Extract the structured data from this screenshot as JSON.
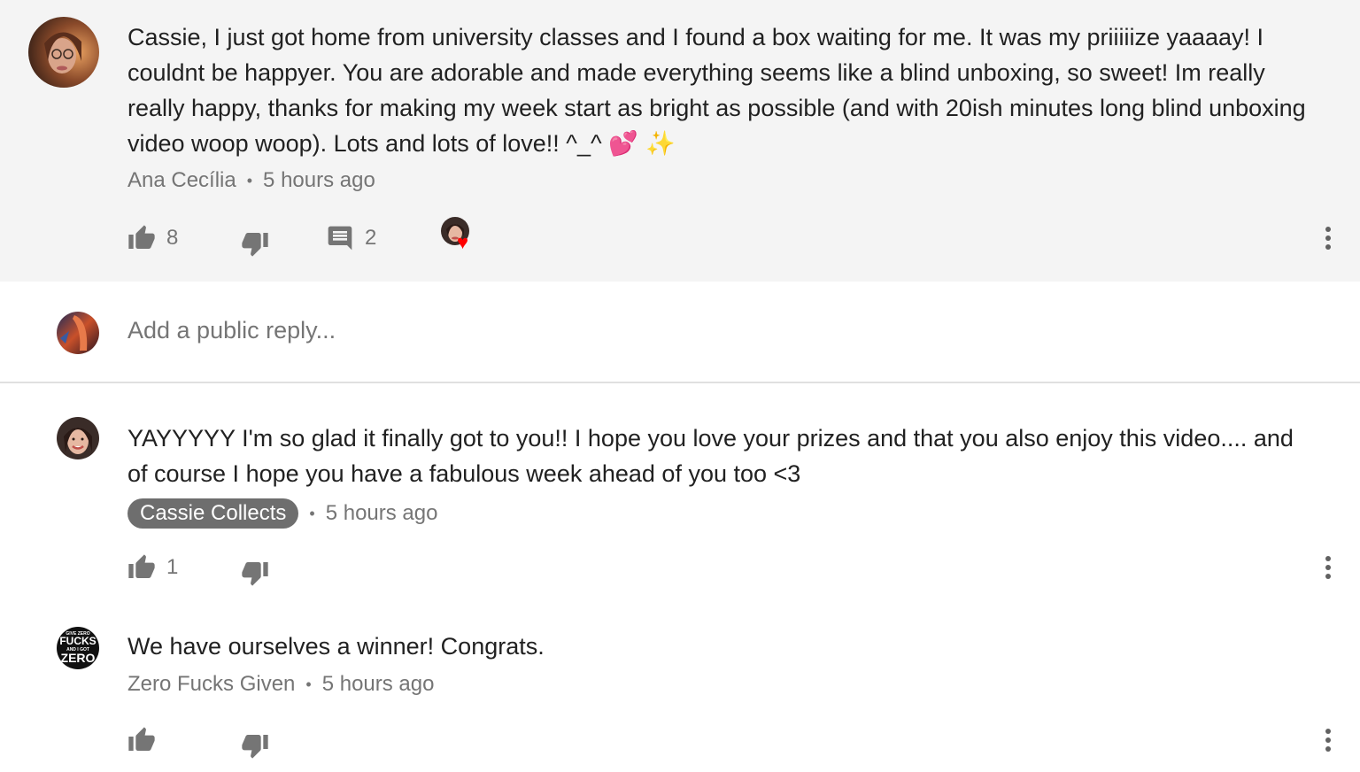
{
  "comments": [
    {
      "text": "Cassie, I just got home from university classes and I found a box waiting for me. It was my priiiiize yaaaay! I couldnt be happyer. You are adorable and made everything seems like a blind unboxing, so sweet! Im really really happy, thanks for making my week start as bright as possible (and with 20ish minutes long blind unboxing video woop woop). Lots and lots of love!! ^_^",
      "emoji": "💕 ✨",
      "author": "Ana Cecília",
      "time": "5 hours ago",
      "likes": "8",
      "replies": "2"
    },
    {
      "text": "YAYYYYY I'm so glad it finally got to you!! I hope you love your prizes and that you also enjoy this video.... and of course I hope you have a fabulous week ahead of you too <3",
      "author": "Cassie Collects",
      "time": "5 hours ago",
      "likes": "1"
    },
    {
      "text": "We have ourselves a winner! Congrats.",
      "author": "Zero Fucks Given",
      "time": "5 hours ago"
    }
  ],
  "reply": {
    "placeholder": "Add a public reply..."
  },
  "avatar_art": {
    "zero_top": "GIVE ZERO",
    "zero_main1": "FUCKS",
    "zero_mid": "AND I GOT",
    "zero_main2": "ZERO"
  },
  "icons": {
    "like": "thumbs-up-icon",
    "dislike": "thumbs-down-icon",
    "reply": "comment-icon",
    "heart": "heart-icon",
    "more": "more-vert-icon"
  },
  "colors": {
    "highlight_bg": "#f4f4f4",
    "icon_gray": "#757575",
    "heart": "#ff0000",
    "badge_bg": "#6e6e6e"
  }
}
